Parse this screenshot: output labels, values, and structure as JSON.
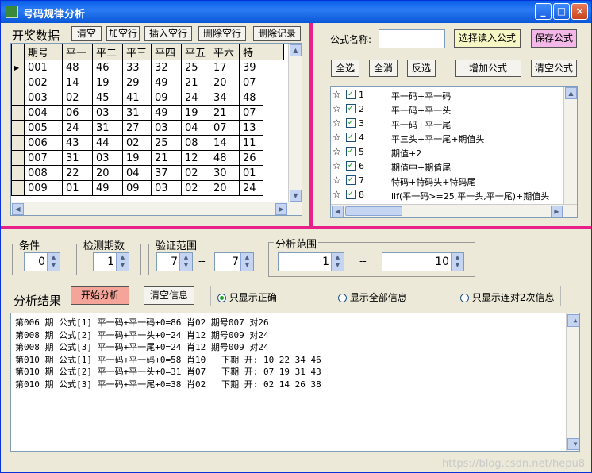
{
  "window": {
    "title": "号码规律分析",
    "min": "_",
    "max": "□",
    "close": "×"
  },
  "draw": {
    "label": "开奖数据",
    "buttons": {
      "clear": "清空",
      "add_row": "加空行",
      "insert_row": "插入空行",
      "delete_row": "删除空行",
      "delete_record": "删除记录"
    },
    "columns": [
      "期号",
      "平一",
      "平二",
      "平三",
      "平四",
      "平五",
      "平六",
      "特"
    ],
    "rows": [
      [
        "001",
        "48",
        "46",
        "33",
        "32",
        "25",
        "17",
        "39"
      ],
      [
        "002",
        "14",
        "19",
        "29",
        "49",
        "21",
        "20",
        "07"
      ],
      [
        "003",
        "02",
        "45",
        "41",
        "09",
        "24",
        "34",
        "48"
      ],
      [
        "004",
        "06",
        "03",
        "31",
        "49",
        "19",
        "21",
        "07"
      ],
      [
        "005",
        "24",
        "31",
        "27",
        "03",
        "04",
        "07",
        "13"
      ],
      [
        "006",
        "43",
        "44",
        "02",
        "25",
        "08",
        "14",
        "11"
      ],
      [
        "007",
        "31",
        "03",
        "19",
        "21",
        "12",
        "48",
        "26"
      ],
      [
        "008",
        "22",
        "20",
        "04",
        "37",
        "02",
        "30",
        "01"
      ],
      [
        "009",
        "01",
        "49",
        "09",
        "03",
        "02",
        "20",
        "24"
      ]
    ]
  },
  "formula": {
    "name_label": "公式名称:",
    "name_value": "",
    "buttons": {
      "load": "选择读入公式",
      "save": "保存公式",
      "select_all": "全选",
      "cancel_all": "全消",
      "invert": "反选",
      "add": "增加公式",
      "clear": "清空公式"
    },
    "items": [
      {
        "star": "☆",
        "check": "✓",
        "num": "1",
        "text": "平一码+平一码"
      },
      {
        "star": "☆",
        "check": "✓",
        "num": "2",
        "text": "平一码+平一头"
      },
      {
        "star": "☆",
        "check": "✓",
        "num": "3",
        "text": "平一码+平一尾"
      },
      {
        "star": "☆",
        "check": "✓",
        "num": "4",
        "text": "平三头+平一尾+期值头"
      },
      {
        "star": "☆",
        "check": "✓",
        "num": "5",
        "text": "期值+2"
      },
      {
        "star": "☆",
        "check": "✓",
        "num": "6",
        "text": "期值中+期值尾"
      },
      {
        "star": "☆",
        "check": "✓",
        "num": "7",
        "text": "特码+特码头+特码尾"
      },
      {
        "star": "☆",
        "check": "✓",
        "num": "8",
        "text": "iif(平一码>=25,平一头,平一尾)+期值头"
      }
    ]
  },
  "params": {
    "condition": {
      "label": "条件",
      "value": "0"
    },
    "check_periods": {
      "label": "检测期数",
      "value": "1"
    },
    "verify_range": {
      "label": "验证范围",
      "from": "7",
      "to": "7",
      "dash": "--"
    },
    "analysis_range": {
      "label": "分析范围",
      "from": "1",
      "to": "10",
      "dash": "--"
    }
  },
  "analysis": {
    "label": "分析结果",
    "start_button": "开始分析",
    "clear_button": "清空信息",
    "radios": [
      {
        "label": "只显示正确",
        "checked": true
      },
      {
        "label": "显示全部信息",
        "checked": false
      },
      {
        "label": "只显示连对2次信息",
        "checked": false
      }
    ],
    "lines": [
      "第006 期 公式[1] 平一码+平一码+0=86 肖02 期号007 对26",
      "第008 期 公式[2] 平一码+平一头+0=24 肖12 期号009 对24",
      "第008 期 公式[3] 平一码+平一尾+0=24 肖12 期号009 对24",
      "第010 期 公式[1] 平一码+平一码+0=58 肖10   下期 开: 10 22 34 46",
      "第010 期 公式[2] 平一码+平一头+0=31 肖07   下期 开: 07 19 31 43",
      "第010 期 公式[3] 平一码+平一尾+0=38 肖02   下期 开: 02 14 26 38"
    ]
  },
  "watermark": "https://blog.csdn.net/hepu8"
}
